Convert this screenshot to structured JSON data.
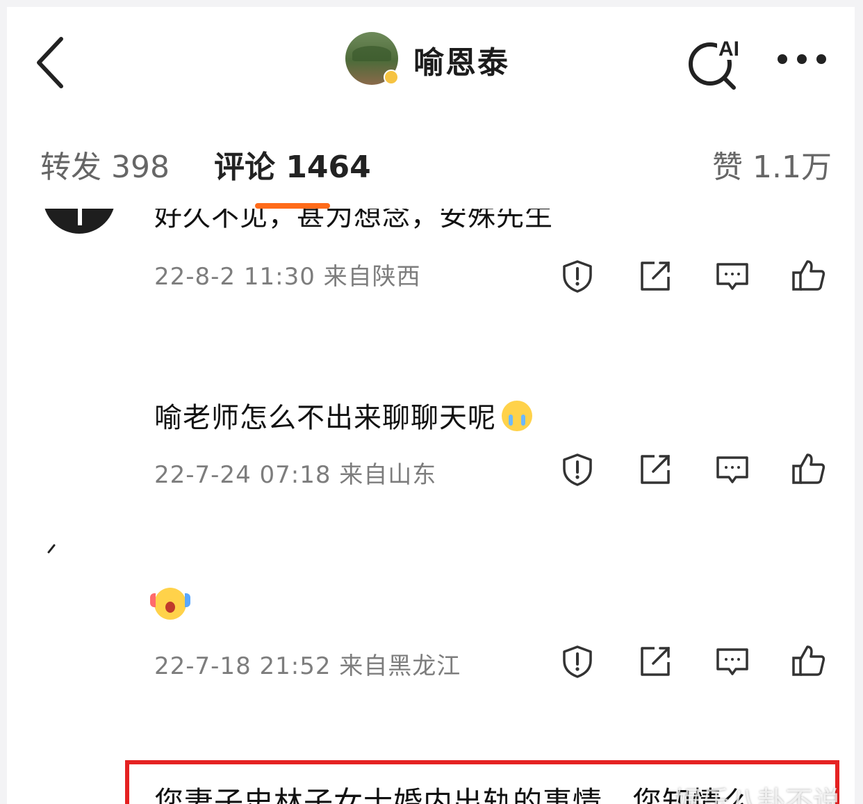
{
  "header": {
    "title": "喻恩泰",
    "ai_label": "AI"
  },
  "tabs": {
    "repost": "转发 398",
    "comment": "评论 1464",
    "like": "赞 1.1万"
  },
  "comments": [
    {
      "text": "好久不见，甚为想念，安殊先生",
      "meta": "22-8-2 11:30 来自陕西"
    },
    {
      "text": "喻老师怎么不出来聊聊天呢",
      "emoji": "crying-face-icon",
      "meta": "22-7-24 07:18 来自山东"
    },
    {
      "text": "",
      "emoji": "screaming-face-icon",
      "meta": "22-7-18 21:52 来自黑龙江"
    },
    {
      "text": "您妻子史林子女士婚内出轨的事情，您知情么"
    }
  ],
  "watermark": "娱乐八卦不说",
  "colors": {
    "accent_orange": "#ff6b1a",
    "highlight_red": "#e52222",
    "meta_gray": "#7d7d7d"
  }
}
